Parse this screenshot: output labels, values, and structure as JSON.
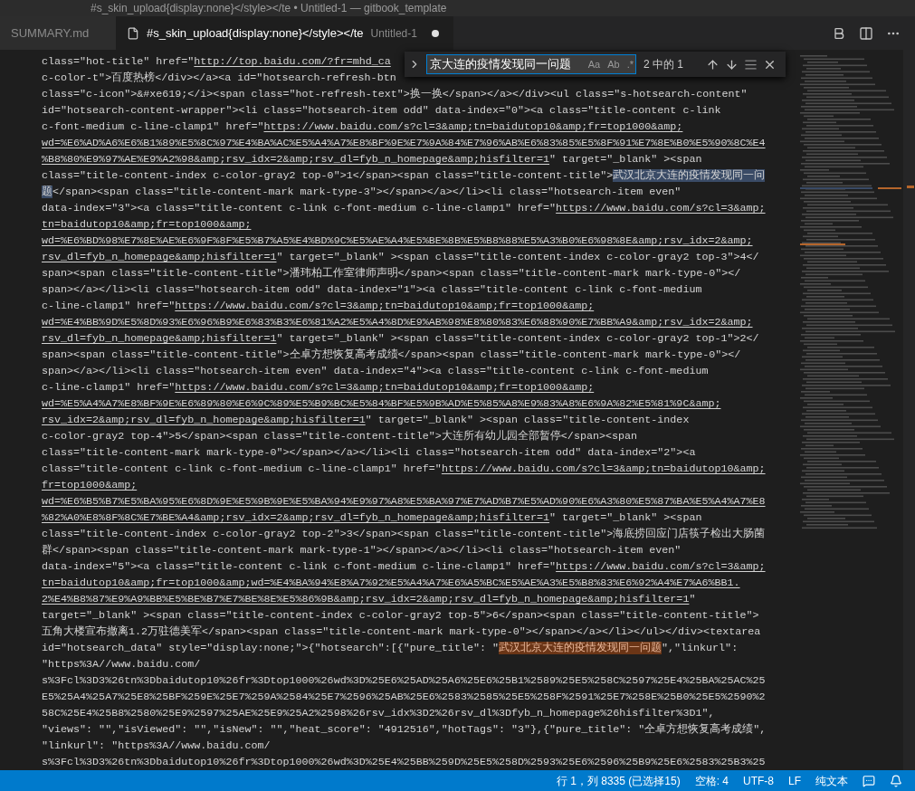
{
  "window": {
    "title": "#s_skin_upload{display:none}</style></te • Untitled-1 — gitbook_template"
  },
  "tabs": [
    {
      "label": "SUMMARY.md",
      "selected": false,
      "dirty": false
    },
    {
      "label": "#s_skin_upload{display:none}</style></te",
      "description": "Untitled-1",
      "selected": true,
      "dirty": true
    }
  ],
  "find_widget": {
    "value": "京大连的疫情发现同一问题",
    "options": [
      "Aa",
      "Ab",
      ".*"
    ],
    "count": "2 中的 1"
  },
  "editor": {
    "lines": [
      [
        {
          "kind": "text",
          "text": "class=\"hot-title\" href=\""
        },
        {
          "kind": "link",
          "text": "http://top.baidu.com/?fr=mhd_ca"
        }
      ],
      [
        {
          "kind": "text",
          "text": "c-color-t\">百度热榜</div></a><a id=\"hotsearch-refresh-btn"
        }
      ],
      [
        {
          "kind": "text",
          "text": "class=\"c-icon\">&#xe619;</i><span class=\"hot-refresh-text\">换一换</span></a></div><ul class=\"s-hotsearch-content\""
        }
      ],
      [
        {
          "kind": "text",
          "text": "id=\"hotsearch-content-wrapper\"><li class=\"hotsearch-item odd\" data-index=\"0\"><a class=\"title-content c-link"
        }
      ],
      [
        {
          "kind": "text",
          "text": "c-font-medium c-line-clamp1\" href=\""
        },
        {
          "kind": "link",
          "text": "https://www.baidu.com/s?cl=3&amp;tn=baidutop10&amp;fr=top1000&amp;"
        }
      ],
      [
        {
          "kind": "link",
          "text": "wd=%E6%AD%A6%E6%B1%89%E5%8C%97%E4%BA%AC%E5%A4%A7%E8%BF%9E%E7%9A%84%E7%96%AB%E6%83%85%E5%8F%91%E7%8E%B0%E5%90%8C%E4"
        }
      ],
      [
        {
          "kind": "link",
          "text": "%B8%80%E9%97%AE%E9%A2%98&amp;rsv_idx=2&amp;rsv_dl=fyb_n_homepage&amp;hisfilter=1"
        },
        {
          "kind": "text",
          "text": "\" target=\"_blank\" ><span"
        }
      ],
      [
        {
          "kind": "text",
          "text": "class=\"title-content-index c-color-gray2 top-0\">1</span><span class=\"title-content-title\">"
        },
        {
          "kind": "selection",
          "text": "武汉北京大连的疫情发现同一问"
        }
      ],
      [
        {
          "kind": "selection",
          "text": "题"
        },
        {
          "kind": "text",
          "text": "</span><span class=\"title-content-mark mark-type-3\"></span></a></li><li class=\"hotsearch-item even\""
        }
      ],
      [
        {
          "kind": "text",
          "text": "data-index=\"3\"><a class=\"title-content c-link c-font-medium c-line-clamp1\" href=\""
        },
        {
          "kind": "link",
          "text": "https://www.baidu.com/s?cl=3&amp;"
        }
      ],
      [
        {
          "kind": "link",
          "text": "tn=baidutop10&amp;fr=top1000&amp;"
        }
      ],
      [
        {
          "kind": "link",
          "text": "wd=%E6%BD%98%E7%8E%AE%E6%9F%8F%E5%B7%A5%E4%BD%9C%E5%AE%A4%E5%BE%8B%E5%B8%88%E5%A3%B0%E6%98%8E&amp;rsv_idx=2&amp;"
        }
      ],
      [
        {
          "kind": "link",
          "text": "rsv_dl=fyb_n_homepage&amp;hisfilter=1"
        },
        {
          "kind": "text",
          "text": "\" target=\"_blank\" ><span class=\"title-content-index c-color-gray2 top-3\">4</"
        }
      ],
      [
        {
          "kind": "text",
          "text": "span><span class=\"title-content-title\">潘玮柏工作室律师声明</span><span class=\"title-content-mark mark-type-0\"></"
        }
      ],
      [
        {
          "kind": "text",
          "text": "span></a></li><li class=\"hotsearch-item odd\" data-index=\"1\"><a class=\"title-content c-link c-font-medium"
        }
      ],
      [
        {
          "kind": "text",
          "text": "c-line-clamp1\" href=\""
        },
        {
          "kind": "link",
          "text": "https://www.baidu.com/s?cl=3&amp;tn=baidutop10&amp;fr=top1000&amp;"
        }
      ],
      [
        {
          "kind": "link",
          "text": "wd=%E4%BB%9D%E5%8D%93%E6%96%B9%E6%83%B3%E6%81%A2%E5%A4%8D%E9%AB%98%E8%80%83%E6%88%90%E7%BB%A9&amp;rsv_idx=2&amp;"
        }
      ],
      [
        {
          "kind": "link",
          "text": "rsv_dl=fyb_n_homepage&amp;hisfilter=1"
        },
        {
          "kind": "text",
          "text": "\" target=\"_blank\" ><span class=\"title-content-index c-color-gray2 top-1\">2</"
        }
      ],
      [
        {
          "kind": "text",
          "text": "span><span class=\"title-content-title\">仝卓方想恢复高考成绩</span><span class=\"title-content-mark mark-type-0\"></"
        }
      ],
      [
        {
          "kind": "text",
          "text": "span></a></li><li class=\"hotsearch-item even\" data-index=\"4\"><a class=\"title-content c-link c-font-medium"
        }
      ],
      [
        {
          "kind": "text",
          "text": "c-line-clamp1\" href=\""
        },
        {
          "kind": "link",
          "text": "https://www.baidu.com/s?cl=3&amp;tn=baidutop10&amp;fr=top1000&amp;"
        }
      ],
      [
        {
          "kind": "link",
          "text": "wd=%E5%A4%A7%E8%BF%9E%E6%89%80%E6%9C%89%E5%B9%BC%E5%84%BF%E5%9B%AD%E5%85%A8%E9%83%A8%E6%9A%82%E5%81%9C&amp;"
        }
      ],
      [
        {
          "kind": "link",
          "text": "rsv_idx=2&amp;rsv_dl=fyb_n_homepage&amp;hisfilter=1"
        },
        {
          "kind": "text",
          "text": "\" target=\"_blank\" ><span class=\"title-content-index"
        }
      ],
      [
        {
          "kind": "text",
          "text": "c-color-gray2 top-4\">5</span><span class=\"title-content-title\">大连所有幼儿园全部暂停</span><span"
        }
      ],
      [
        {
          "kind": "text",
          "text": "class=\"title-content-mark mark-type-0\"></span></a></li><li class=\"hotsearch-item odd\" data-index=\"2\"><a"
        }
      ],
      [
        {
          "kind": "text",
          "text": "class=\"title-content c-link c-font-medium c-line-clamp1\" href=\""
        },
        {
          "kind": "link",
          "text": "https://www.baidu.com/s?cl=3&amp;tn=baidutop10&amp;"
        }
      ],
      [
        {
          "kind": "link",
          "text": "fr=top1000&amp;"
        }
      ],
      [
        {
          "kind": "link",
          "text": "wd=%E6%B5%B7%E5%BA%95%E6%8D%9E%E5%9B%9E%E5%BA%94%E9%97%A8%E5%BA%97%E7%AD%B7%E5%AD%90%E6%A3%80%E5%87%BA%E5%A4%A7%E8"
        }
      ],
      [
        {
          "kind": "link",
          "text": "%82%A0%E8%8F%8C%E7%BE%A4&amp;rsv_idx=2&amp;rsv_dl=fyb_n_homepage&amp;hisfilter=1"
        },
        {
          "kind": "text",
          "text": "\" target=\"_blank\" ><span"
        }
      ],
      [
        {
          "kind": "text",
          "text": "class=\"title-content-index c-color-gray2 top-2\">3</span><span class=\"title-content-title\">海底捞回应门店筷子检出大肠菌"
        }
      ],
      [
        {
          "kind": "text",
          "text": "群</span><span class=\"title-content-mark mark-type-1\"></span></a></li><li class=\"hotsearch-item even\""
        }
      ],
      [
        {
          "kind": "text",
          "text": "data-index=\"5\"><a class=\"title-content c-link c-font-medium c-line-clamp1\" href=\""
        },
        {
          "kind": "link",
          "text": "https://www.baidu.com/s?cl=3&amp;"
        }
      ],
      [
        {
          "kind": "link",
          "text": "tn=baidutop10&amp;fr=top1000&amp;wd=%E4%BA%94%E8%A7%92%E5%A4%A7%E6%A5%BC%E5%AE%A3%E5%B8%83%E6%92%A4%E7%A6%BB1."
        }
      ],
      [
        {
          "kind": "link",
          "text": "2%E4%B8%87%E9%A9%BB%E5%BE%B7%E7%BE%8E%E5%86%9B&amp;rsv_idx=2&amp;rsv_dl=fyb_n_homepage&amp;hisfilter=1"
        },
        {
          "kind": "text",
          "text": "\""
        }
      ],
      [
        {
          "kind": "text",
          "text": "target=\"_blank\" ><span class=\"title-content-index c-color-gray2 top-5\">6</span><span class=\"title-content-title\">"
        }
      ],
      [
        {
          "kind": "text",
          "text": "五角大楼宣布撤离1.2万驻德美军</span><span class=\"title-content-mark mark-type-0\"></span></a></li></ul></div><textarea"
        }
      ],
      [
        {
          "kind": "text",
          "text": "id=\"hotsearch_data\" style=\"display:none;\">{\"hotsearch\":[{\"pure_title\": \""
        },
        {
          "kind": "match",
          "text": "武汉北京大连的疫情发现同一问题"
        },
        {
          "kind": "text",
          "text": "\",\"linkurl\":"
        }
      ],
      [
        {
          "kind": "text",
          "text": "\"https%3A//www.baidu.com/"
        }
      ],
      [
        {
          "kind": "text",
          "text": "s%3Fcl%3D3%26tn%3Dbaidutop10%26fr%3Dtop1000%26wd%3D%25E6%25AD%25A6%25E6%25B1%2589%25E5%258C%2597%25E4%25BA%25AC%25"
        }
      ],
      [
        {
          "kind": "text",
          "text": "E5%25A4%25A7%25E8%25BF%259E%25E7%259A%2584%25E7%2596%25AB%25E6%2583%2585%25E5%258F%2591%25E7%258E%25B0%25E5%2590%2"
        }
      ],
      [
        {
          "kind": "text",
          "text": "58C%25E4%25B8%2580%25E9%2597%25AE%25E9%25A2%2598%26rsv_idx%3D2%26rsv_dl%3Dfyb_n_homepage%26hisfilter%3D1\","
        }
      ],
      [
        {
          "kind": "text",
          "text": "\"views\": \"\",\"isViewed\": \"\",\"isNew\": \"\",\"heat_score\": \"4912516\",\"hotTags\": \"3\"},{\"pure_title\": \"仝卓方想恢复高考成绩\","
        }
      ],
      [
        {
          "kind": "text",
          "text": "\"linkurl\": \"https%3A//www.baidu.com/"
        }
      ],
      [
        {
          "kind": "text",
          "text": "s%3Fcl%3D3%26tn%3Dbaidutop10%26fr%3Dtop1000%26wd%3D%25E4%25BB%259D%25E5%258D%2593%25E6%2596%25B9%25E6%2583%25B3%25"
        }
      ]
    ]
  },
  "status_bar": {
    "items": [
      "行 1，列 8335 (已选择15)",
      "空格: 4",
      "UTF-8",
      "LF",
      "纯文本"
    ]
  }
}
